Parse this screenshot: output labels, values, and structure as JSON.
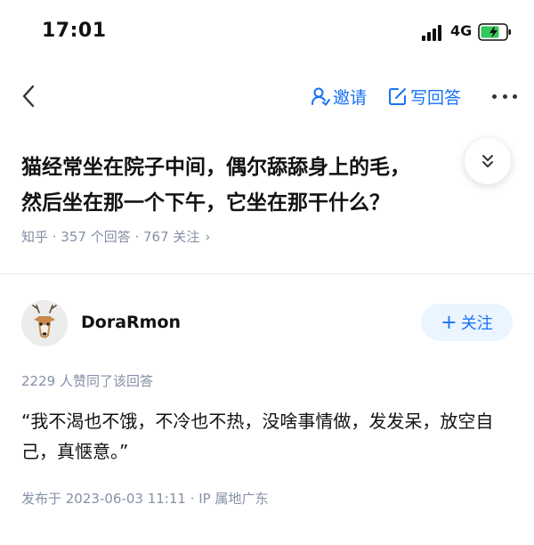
{
  "status_bar": {
    "time": "17:01",
    "network": "4G",
    "icons": [
      "signal-icon",
      "battery-charging-icon"
    ]
  },
  "nav": {
    "back_icon": "chevron-left-icon",
    "invite_label": "邀请",
    "write_answer_label": "写回答",
    "more_icon": "ellipsis-icon"
  },
  "question": {
    "title_line1": "猫经常坐在院子中间，偶尔舔舔身上的毛，",
    "title_line2": "然后坐在那一个下午，它坐在那干什么？",
    "meta": "知乎 · 357 个回答 · 767 关注",
    "meta_chevron": "›",
    "expand_icon": "double-chevron-down-icon"
  },
  "answer": {
    "author_name": "DoraRmon",
    "follow_plus": "+",
    "follow_label": "关注",
    "likes_text": "2229 人赞同了该回答",
    "content": "“我不渴也不饿，不冷也不热，没啥事情做，发发呆，放空自己，真惬意。”",
    "published": "发布于 2023-06-03 11:11 · IP 属地广东"
  },
  "colors": {
    "accent": "#1772f6",
    "follow_bg": "#ebf5ff",
    "meta_gray": "#8590a6",
    "text": "#121212",
    "battery_green": "#34c759"
  }
}
